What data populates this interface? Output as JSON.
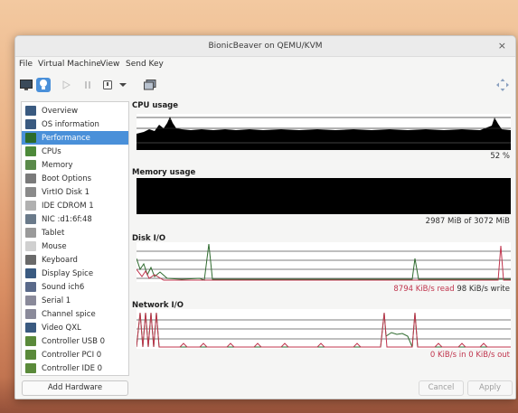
{
  "window": {
    "title": "BionicBeaver on QEMU/KVM",
    "close": "×"
  },
  "menu": [
    "File",
    "Virtual Machine",
    "View",
    "Send Key"
  ],
  "toolbar": {
    "icons": [
      "monitor-icon",
      "lightbulb-icon",
      "play-icon",
      "pause-icon",
      "power-icon",
      "dropdown-arrow-icon",
      "snapshot-icon",
      "fullscreen-icon"
    ],
    "active": "lightbulb-icon"
  },
  "sidebar": {
    "selected": 2,
    "items": [
      {
        "label": "Overview",
        "icon": "monitor-icon"
      },
      {
        "label": "OS information",
        "icon": "monitor-icon"
      },
      {
        "label": "Performance",
        "icon": "performance-icon"
      },
      {
        "label": "CPUs",
        "icon": "cpu-icon"
      },
      {
        "label": "Memory",
        "icon": "memory-icon"
      },
      {
        "label": "Boot Options",
        "icon": "gear-icon"
      },
      {
        "label": "VirtIO Disk 1",
        "icon": "disk-icon"
      },
      {
        "label": "IDE CDROM 1",
        "icon": "cdrom-icon"
      },
      {
        "label": "NIC :d1:6f:48",
        "icon": "nic-icon"
      },
      {
        "label": "Tablet",
        "icon": "tablet-icon"
      },
      {
        "label": "Mouse",
        "icon": "mouse-icon"
      },
      {
        "label": "Keyboard",
        "icon": "keyboard-icon"
      },
      {
        "label": "Display Spice",
        "icon": "display-icon"
      },
      {
        "label": "Sound ich6",
        "icon": "sound-icon"
      },
      {
        "label": "Serial 1",
        "icon": "serial-icon"
      },
      {
        "label": "Channel spice",
        "icon": "channel-icon"
      },
      {
        "label": "Video QXL",
        "icon": "video-icon"
      },
      {
        "label": "Controller USB 0",
        "icon": "controller-icon"
      },
      {
        "label": "Controller PCI 0",
        "icon": "controller-icon"
      },
      {
        "label": "Controller IDE 0",
        "icon": "controller-icon"
      }
    ],
    "add_hardware": "Add Hardware"
  },
  "buttons": {
    "cancel": "Cancel",
    "apply": "Apply"
  },
  "performance": {
    "cpu": {
      "title": "CPU usage",
      "value": "52 %"
    },
    "memory": {
      "title": "Memory usage",
      "value": "2987 MiB of 3072 MiB"
    },
    "disk": {
      "title": "Disk I/O",
      "read": "8794 KiB/s read",
      "write": "98 KiB/s write"
    },
    "network": {
      "title": "Network I/O",
      "in": "0 KiB/s in",
      "out": "0 KiB/s out"
    }
  },
  "colors": {
    "accent": "#4a90d9",
    "graph_fill": "#000000",
    "read_series": "#2f6b2f",
    "write_series": "#c0344d"
  }
}
